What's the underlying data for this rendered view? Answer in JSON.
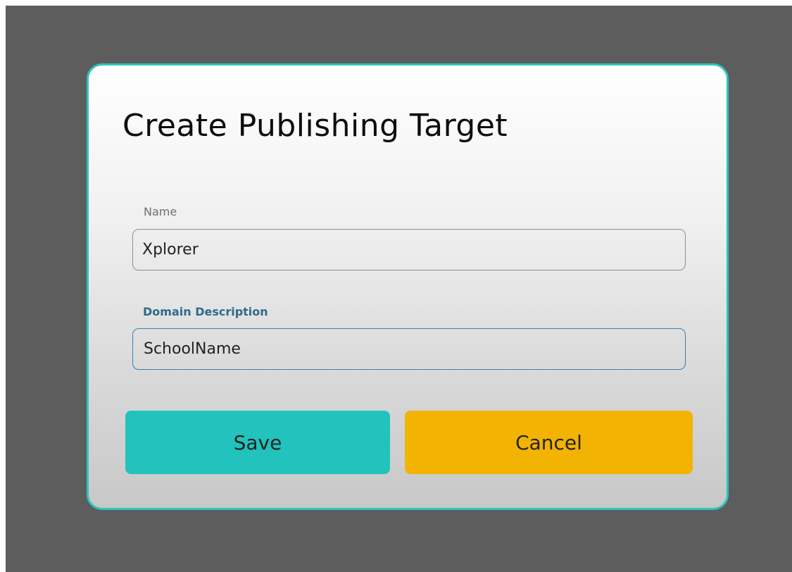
{
  "dialog": {
    "title": "Create Publishing Target",
    "fields": {
      "name": {
        "label": "Name",
        "value": "Xplorer"
      },
      "domain_description": {
        "label": "Domain Description",
        "value": "SchoolName",
        "focused": true
      }
    },
    "buttons": {
      "save_label": "Save",
      "cancel_label": "Cancel"
    }
  },
  "colors": {
    "backdrop": "#5d5d5d",
    "dialog_border": "#2ec4bc",
    "save_button": "#22c3bd",
    "cancel_button": "#f2b303",
    "focused_label": "#2f6a8a",
    "focused_border": "#3b7fae"
  }
}
